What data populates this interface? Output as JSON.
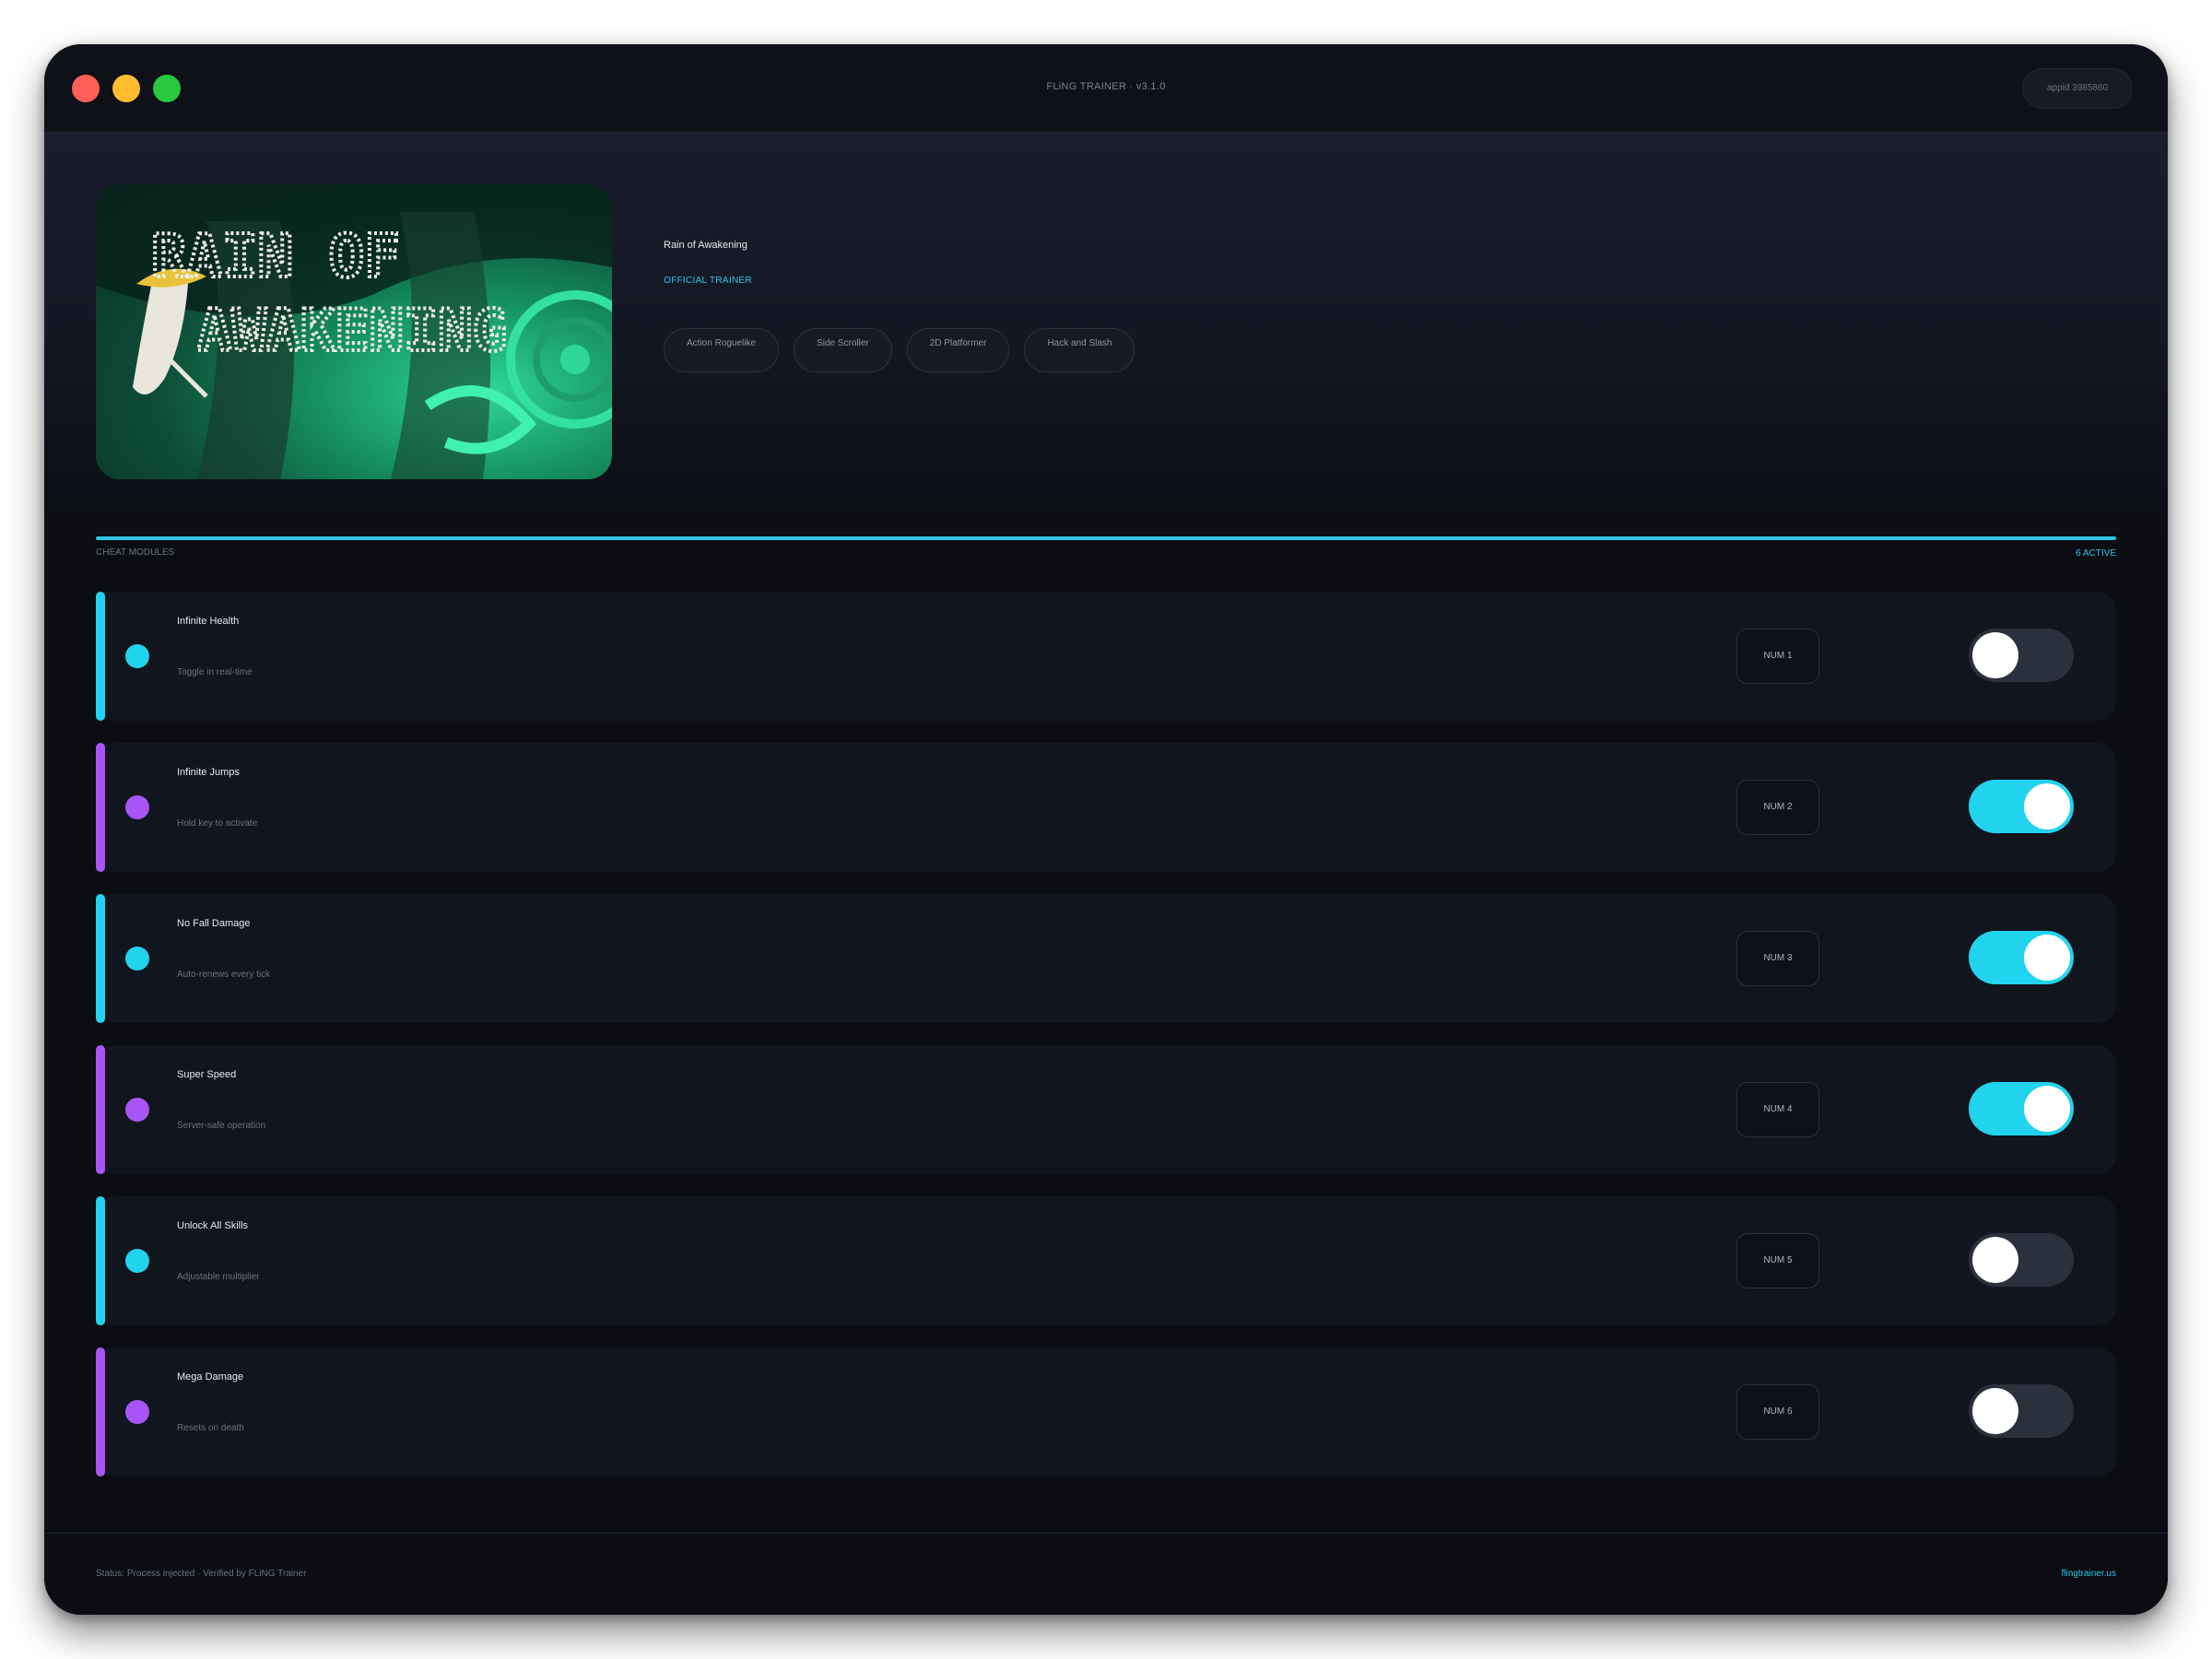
{
  "window": {
    "title": "FLiNG TRAINER · v3.1.0",
    "appid": "appid 3985860"
  },
  "game": {
    "title": "Rain of Awakening",
    "trainer_label": "OFFICIAL TRAINER",
    "cover_text_line1": "RAIN OF",
    "cover_text_line2": "AWAKENING",
    "tags": [
      "Action Roguelike",
      "Side Scroller",
      "2D Platformer",
      "Hack and Slash"
    ]
  },
  "section": {
    "label": "CHEAT MODULES",
    "active_count": "6 ACTIVE"
  },
  "colors": {
    "cyan": "#22d3ee",
    "purple": "#a855f7",
    "toggle_off": "#2b303d"
  },
  "cheats": [
    {
      "name": "Infinite Health",
      "desc": "Toggle in real-time",
      "hotkey": "NUM 1",
      "accent": "cyan",
      "enabled": false
    },
    {
      "name": "Infinite Jumps",
      "desc": "Hold key to activate",
      "hotkey": "NUM 2",
      "accent": "purple",
      "enabled": true
    },
    {
      "name": "No Fall Damage",
      "desc": "Auto-renews every tick",
      "hotkey": "NUM 3",
      "accent": "cyan",
      "enabled": true
    },
    {
      "name": "Super Speed",
      "desc": "Server-safe operation",
      "hotkey": "NUM 4",
      "accent": "purple",
      "enabled": true
    },
    {
      "name": "Unlock All Skills",
      "desc": "Adjustable multiplier",
      "hotkey": "NUM 5",
      "accent": "cyan",
      "enabled": false
    },
    {
      "name": "Mega Damage",
      "desc": "Resets on death",
      "hotkey": "NUM 6",
      "accent": "purple",
      "enabled": false
    }
  ],
  "footer": {
    "status": "Status: Process injected · Verified by FLiNG Trainer",
    "link": "flingtrainer.us"
  }
}
